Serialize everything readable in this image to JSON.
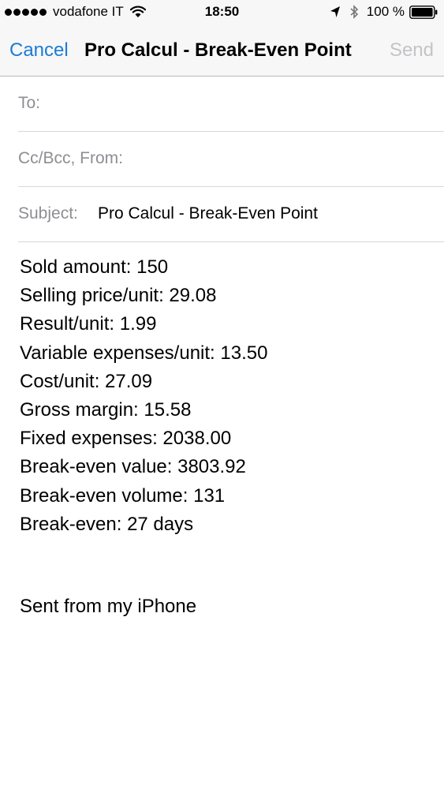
{
  "status_bar": {
    "carrier": "vodafone IT",
    "time": "18:50",
    "battery": "100 %",
    "icons": [
      "signal-dots",
      "wifi-icon",
      "location-icon",
      "bluetooth-icon",
      "battery-icon"
    ]
  },
  "nav": {
    "cancel_label": "Cancel",
    "title": "Pro Calcul - Break-Even Point",
    "send_label": "Send",
    "accent_color": "#1a7cd6",
    "disabled_color": "#c4c4c8"
  },
  "fields": {
    "to_label": "To:",
    "cc_label": "Cc/Bcc, From:",
    "subject_label": "Subject:",
    "subject_value": "Pro Calcul - Break-Even Point"
  },
  "body": {
    "lines": [
      "Sold amount: 150",
      "Selling price/unit: 29.08",
      "Result/unit: 1.99",
      "Variable expenses/unit: 13.50",
      "Cost/unit: 27.09",
      "Gross margin: 15.58",
      "Fixed expenses: 2038.00",
      "Break-even value: 3803.92",
      "Break-even volume: 131",
      "Break-even: 27 days"
    ],
    "signature": "Sent from my iPhone"
  }
}
